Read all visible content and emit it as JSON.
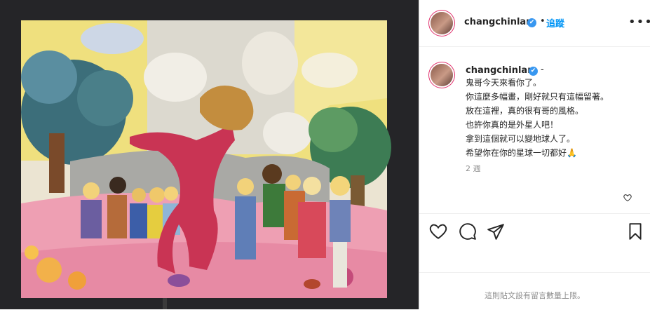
{
  "post": {
    "image_alt": "painting",
    "username": "changchinlan",
    "verified_mark": "✔",
    "separator": "•",
    "follow_label": "追蹤",
    "more_label": "•••",
    "caption_dash": "-",
    "caption_lines": [
      "鬼哥今天來看你了。",
      "你這麼多幅畫，剛好就只有這幅留著。",
      "放在這裡，真的很有哥的風格。",
      "也許你真的是外星人吧！",
      "拿到這個就可以變地球人了。",
      "希望你在你的星球一切都好🙏"
    ],
    "time_ago": "2 週",
    "comments_notice": "這則貼文設有留言數量上限。"
  },
  "icons": {
    "like": "heart-icon",
    "comment": "comment-icon",
    "share": "share-icon",
    "save": "bookmark-icon"
  }
}
